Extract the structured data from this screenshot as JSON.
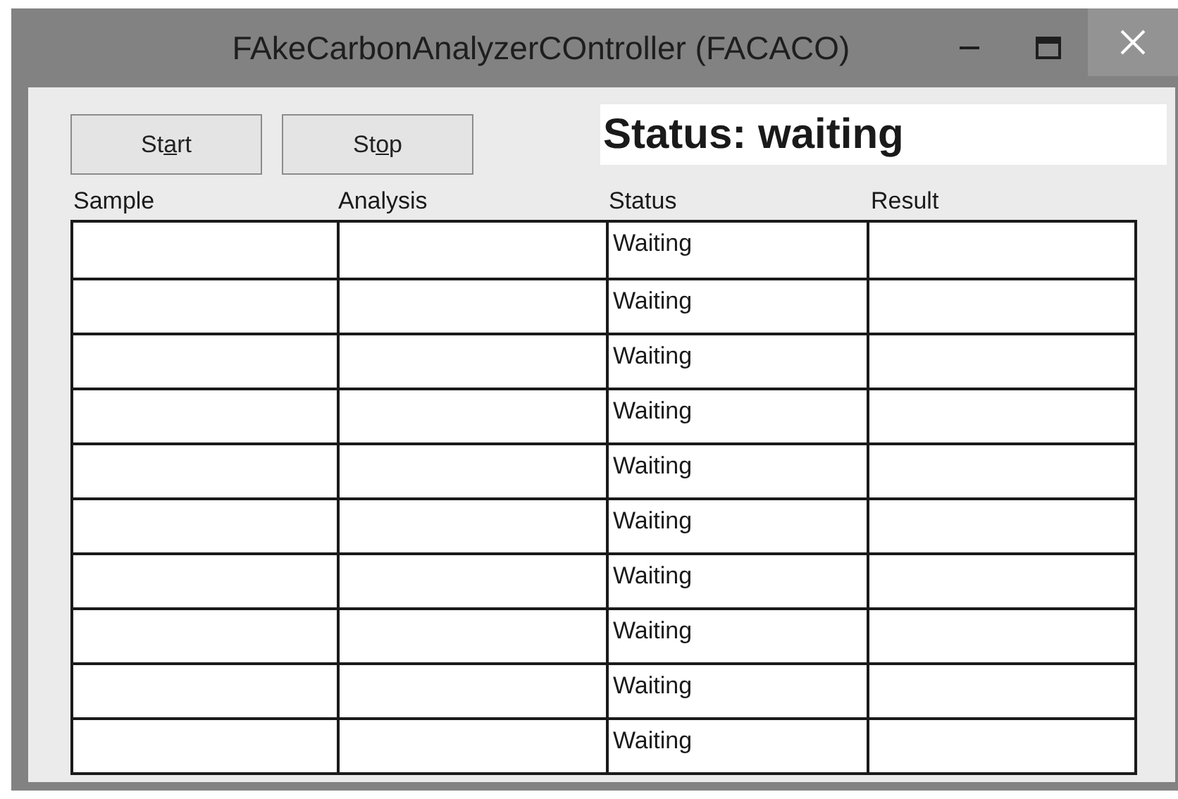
{
  "window": {
    "title": "FAkeCarbonAnalyzerCOntroller (FACACO)"
  },
  "buttons": [
    {
      "label_before_key": "St",
      "access_key": "a",
      "label_after_key": "rt"
    },
    {
      "label_before_key": "St",
      "access_key": "o",
      "label_after_key": "p"
    }
  ],
  "status_label": "Status: waiting",
  "table": {
    "columns": [
      "Sample",
      "Analysis",
      "Status",
      "Result"
    ],
    "rows": [
      [
        "",
        "",
        "Waiting",
        ""
      ],
      [
        "",
        "",
        "Waiting",
        ""
      ],
      [
        "",
        "",
        "Waiting",
        ""
      ],
      [
        "",
        "",
        "Waiting",
        ""
      ],
      [
        "",
        "",
        "Waiting",
        ""
      ],
      [
        "",
        "",
        "Waiting",
        ""
      ],
      [
        "",
        "",
        "Waiting",
        ""
      ],
      [
        "",
        "",
        "Waiting",
        ""
      ],
      [
        "",
        "",
        "Waiting",
        ""
      ],
      [
        "",
        "",
        "Waiting",
        ""
      ]
    ]
  }
}
